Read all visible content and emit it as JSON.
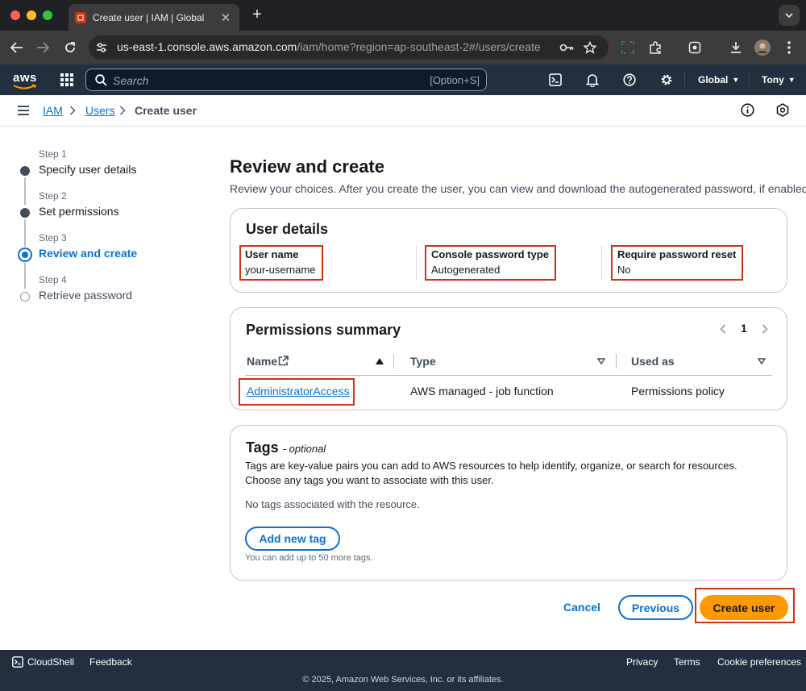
{
  "browser": {
    "tab_title": "Create user | IAM | Global",
    "url_host": "us-east-1.console.aws.amazon.com",
    "url_path": "/iam/home?region=ap-southeast-2#/users/create"
  },
  "aws_nav": {
    "logo": "aws",
    "search_placeholder": "Search",
    "search_shortcut": "[Option+S]",
    "region": "Global",
    "user": "Tony"
  },
  "breadcrumb": [
    "IAM",
    "Users",
    "Create user"
  ],
  "steps": [
    {
      "label": "Step 1",
      "name": "Specify user details",
      "state": "done"
    },
    {
      "label": "Step 2",
      "name": "Set permissions",
      "state": "done"
    },
    {
      "label": "Step 3",
      "name": "Review and create",
      "state": "current"
    },
    {
      "label": "Step 4",
      "name": "Retrieve password",
      "state": "pending"
    }
  ],
  "main": {
    "title": "Review and create",
    "description": "Review your choices. After you create the user, you can view and download the autogenerated password, if enabled."
  },
  "user_details": {
    "title": "User details",
    "fields": [
      {
        "key": "User name",
        "value": "your-username"
      },
      {
        "key": "Console password type",
        "value": "Autogenerated"
      },
      {
        "key": "Require password reset",
        "value": "No"
      }
    ]
  },
  "permissions": {
    "title": "Permissions summary",
    "page": "1",
    "columns": [
      "Name",
      "Type",
      "Used as"
    ],
    "rows": [
      {
        "name": "AdministratorAccess",
        "type": "AWS managed - job function",
        "used_as": "Permissions policy"
      }
    ]
  },
  "tags": {
    "title": "Tags",
    "optional": "- optional",
    "desc1": "Tags are key-value pairs you can add to AWS resources to help identify, organize, or search for resources.",
    "desc2": "Choose any tags you want to associate with this user.",
    "empty": "No tags associated with the resource.",
    "add_button": "Add new tag",
    "limit": "You can add up to 50 more tags."
  },
  "actions": {
    "cancel": "Cancel",
    "previous": "Previous",
    "create": "Create user"
  },
  "footer": {
    "cloudshell": "CloudShell",
    "feedback": "Feedback",
    "privacy": "Privacy",
    "terms": "Terms",
    "cookies": "Cookie preferences",
    "copyright": "© 2025, Amazon Web Services, Inc. or its affiliates."
  },
  "colors": {
    "highlight": "#d13212",
    "link": "#0972d3",
    "primary_button": "#ff9900",
    "nav_bg": "#232f3e"
  }
}
